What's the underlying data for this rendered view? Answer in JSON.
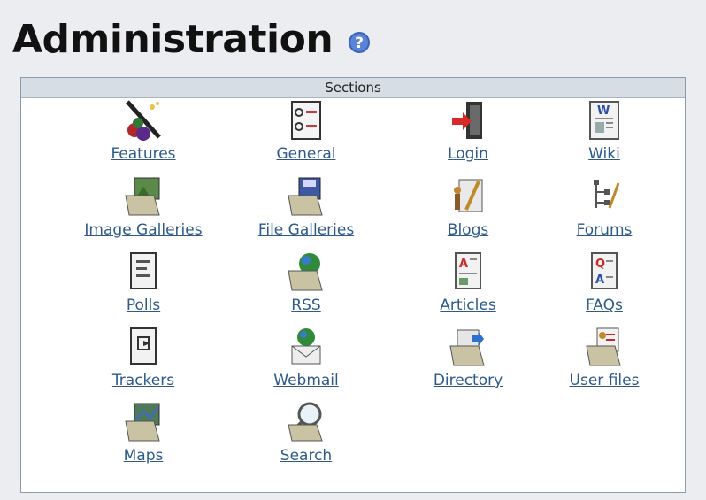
{
  "header": {
    "title": "Administration",
    "help_icon": "help-icon"
  },
  "panel": {
    "title": "Sections",
    "items": [
      {
        "label": "Features",
        "icon": "features-icon"
      },
      {
        "label": "General",
        "icon": "general-icon"
      },
      {
        "label": "Login",
        "icon": "login-icon"
      },
      {
        "label": "Wiki",
        "icon": "wiki-icon"
      },
      {
        "label": "Image Galleries",
        "icon": "image-galleries-icon"
      },
      {
        "label": "File Galleries",
        "icon": "file-galleries-icon"
      },
      {
        "label": "Blogs",
        "icon": "blogs-icon"
      },
      {
        "label": "Forums",
        "icon": "forums-icon"
      },
      {
        "label": "Polls",
        "icon": "polls-icon"
      },
      {
        "label": "RSS",
        "icon": "rss-icon"
      },
      {
        "label": "Articles",
        "icon": "articles-icon"
      },
      {
        "label": "FAQs",
        "icon": "faqs-icon"
      },
      {
        "label": "Trackers",
        "icon": "trackers-icon"
      },
      {
        "label": "Webmail",
        "icon": "webmail-icon"
      },
      {
        "label": "Directory",
        "icon": "directory-icon"
      },
      {
        "label": "User files",
        "icon": "user-files-icon"
      },
      {
        "label": "Maps",
        "icon": "maps-icon"
      },
      {
        "label": "Search",
        "icon": "search-icon"
      }
    ]
  },
  "colors": {
    "link": "#2d5a8a",
    "header_bg": "#d7dde4",
    "page_bg": "#ebedf0"
  }
}
